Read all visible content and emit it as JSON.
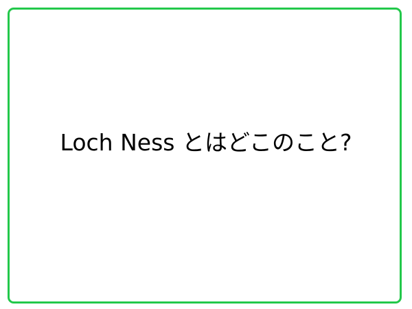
{
  "card": {
    "question": "Loch Ness とはどこのこと?"
  },
  "colors": {
    "border": "#22c84a",
    "background": "#ffffff",
    "text": "#000000"
  }
}
